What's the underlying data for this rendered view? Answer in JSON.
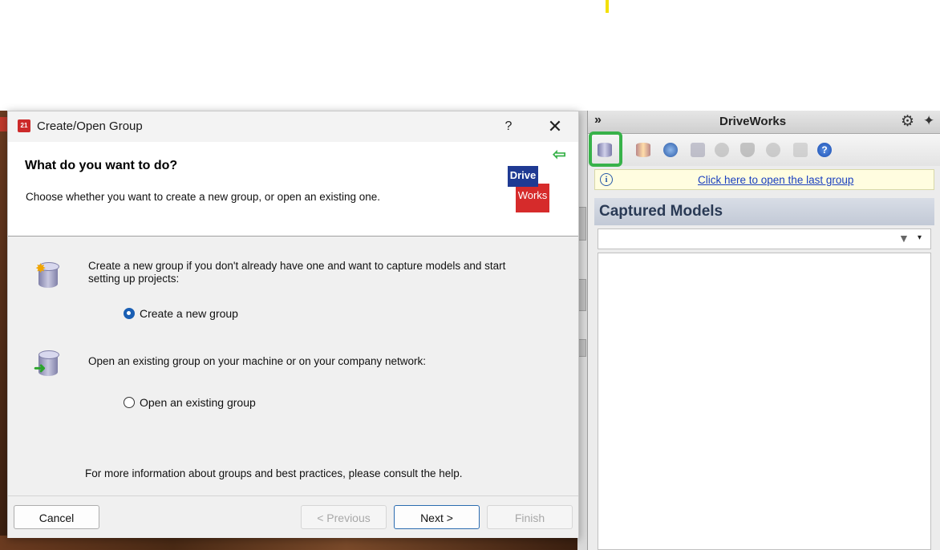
{
  "dialog": {
    "title": "Create/Open Group",
    "app_icon": "21",
    "help_label": "?",
    "close_label": "✕",
    "header_title": "What do you want to do?",
    "header_subtitle": "Choose whether you want to create a new group, or open an existing one.",
    "logo_line1": "Drive",
    "logo_line2": "Works",
    "create_description": "Create a new group if you don't already have one and want to capture models and start setting up projects:",
    "create_radio_label": "Create a new group",
    "create_selected": true,
    "open_description": "Open an existing group on your machine or on your company network:",
    "open_radio_label": "Open an existing group",
    "open_selected": false,
    "help_info": "For more information about groups and best practices, please consult the help.",
    "buttons": {
      "cancel": "Cancel",
      "previous": "< Previous",
      "next": "Next >",
      "finish": "Finish"
    }
  },
  "pane": {
    "expand_label": "»",
    "title": "DriveWorks",
    "gear_icon": "⚙",
    "pin_icon": "✦",
    "info_icon": "i",
    "open_last_link": "Click here to open the last group",
    "section_title": "Captured Models",
    "filter_icon": "▼",
    "filter_dropdown": "▾"
  },
  "colors": {
    "highlight": "#38b24a",
    "link": "#1a3fbf",
    "radio_selected": "#1a5fb4"
  }
}
